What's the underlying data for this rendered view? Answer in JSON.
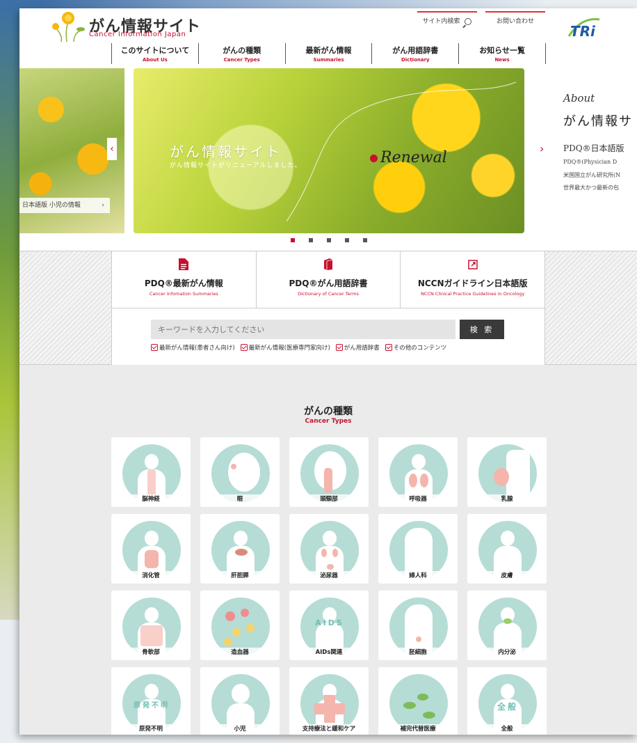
{
  "header": {
    "logo_title": "がん情報サイト",
    "logo_subtitle": "Cancer Information Japan",
    "site_search_label": "サイト内検索",
    "contact_label": "お問い合わせ",
    "partner_logo_text": "TRi"
  },
  "nav": [
    {
      "jp": "このサイトについて",
      "en": "About Us"
    },
    {
      "jp": "がんの種類",
      "en": "Cancer Types"
    },
    {
      "jp": "最新がん情報",
      "en": "Summaries"
    },
    {
      "jp": "がん用語辞書",
      "en": "Dictionary"
    },
    {
      "jp": "お知らせ一覧",
      "en": "News"
    }
  ],
  "carousel": {
    "left_label": "日本語版 小児の情報",
    "main_title": "がん情報サイト",
    "main_subtitle": "がん情報サイトがリニューアルしました。",
    "renewal_text": "Renewal",
    "right_script": "About",
    "right_title": "がん情報サ",
    "right_pdq": "PDQ®日本語版",
    "right_line1": "PDQ®(Physician D",
    "right_line2": "米国国立がん研究所(N",
    "right_line3": "世界最大かつ最新の包",
    "prev_arrow": "‹",
    "next_arrow": "›",
    "dots_count": 5,
    "active_dot": 0
  },
  "quick_links": [
    {
      "title": "PDQ®最新がん情報",
      "subtitle": "Cancer Infomation Summaries",
      "icon": "document-icon"
    },
    {
      "title": "PDQ®がん用語辞書",
      "subtitle": "Dictionary of Cancer Terms",
      "icon": "book-icon"
    },
    {
      "title": "NCCNガイドライン日本語版",
      "subtitle": "NCCN Clinical Practice Guidelines in Oncology",
      "icon": "external-link-icon"
    }
  ],
  "search": {
    "placeholder": "キーワードを入力してください",
    "button_label": "検 索",
    "options": [
      "最新がん情報(患者さん向け)",
      "最新がん情報(医療専門家向け)",
      "がん用語辞書",
      "その他のコンテンツ"
    ]
  },
  "cancer_types": {
    "title": "がんの種類",
    "subtitle": "Cancer Types",
    "items": [
      "脳神経",
      "眼",
      "頭頸部",
      "呼吸器",
      "乳腺",
      "消化管",
      "肝胆膵",
      "泌尿器",
      "婦人科",
      "皮膚",
      "骨軟部",
      "造血器",
      "AIDs関連",
      "胚細胞",
      "内分泌",
      "原発不明",
      "小児",
      "支持療法と緩和ケア",
      "補完代替医療",
      "全般"
    ],
    "overlay_text": {
      "aids": "AIDS",
      "unknown": "原発不明",
      "general": "全般"
    }
  },
  "colors": {
    "accent": "#c8102e",
    "teal": "#b6dcd6",
    "dark_button": "#3a3a3a"
  }
}
